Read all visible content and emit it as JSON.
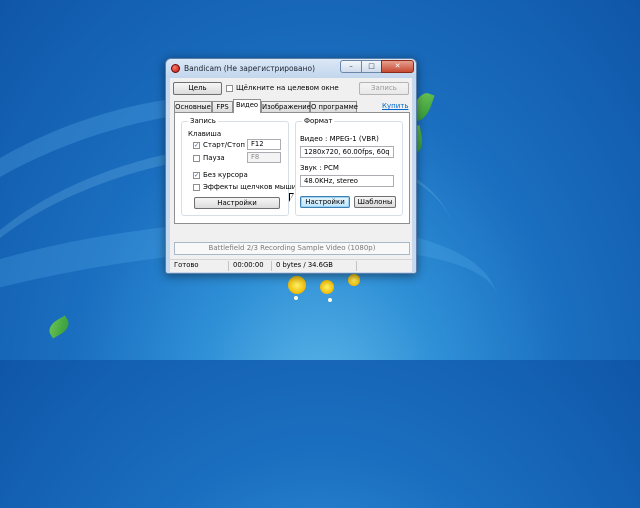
{
  "window": {
    "title": "Bandicam (Не зарегистрировано)",
    "min_glyph": "–",
    "max_glyph": "□",
    "close_glyph": "✕"
  },
  "toolbar": {
    "target_button": "Цель",
    "click_target_checkbox": "Щёлкните на целевом окне",
    "click_target_checked": false,
    "record_button": "Запись"
  },
  "tabs": [
    {
      "label": "Основные",
      "active": false
    },
    {
      "label": "FPS",
      "active": false
    },
    {
      "label": "Видео",
      "active": true
    },
    {
      "label": "Изображение",
      "active": false
    },
    {
      "label": "О программе",
      "active": false
    }
  ],
  "buy_link": "Купить",
  "record_group": {
    "title": "Запись",
    "hotkey_heading": "Клавиша",
    "start_stop_label": "Старт/Стоп",
    "start_stop_checked": true,
    "start_stop_key": "F12",
    "pause_label": "Пауза",
    "pause_checked": false,
    "pause_key": "F8",
    "no_cursor_label": "Без курсора",
    "no_cursor_checked": true,
    "mouse_effects_label": "Эффекты щелчков мыши",
    "mouse_effects_checked": false,
    "settings_button": "Настройки"
  },
  "format_group": {
    "title": "Формат",
    "video_label": "Видео : MPEG-1 (VBR)",
    "video_value": "1280x720, 60.00fps, 60q",
    "audio_label": "Звук : PCM",
    "audio_value": "48.0KHz, stereo",
    "settings_button": "Настройки",
    "templates_button": "Шаблоны"
  },
  "sample_bar": "Battlefield 2/3 Recording Sample Video (1080p)",
  "statusbar": {
    "status": "Готово",
    "time": "00:00:00",
    "size": "0 bytes / 34.6GB"
  },
  "colors": {
    "desktop": "#1b6fc0",
    "link": "#0066cc",
    "close_button": "#c64a34"
  }
}
